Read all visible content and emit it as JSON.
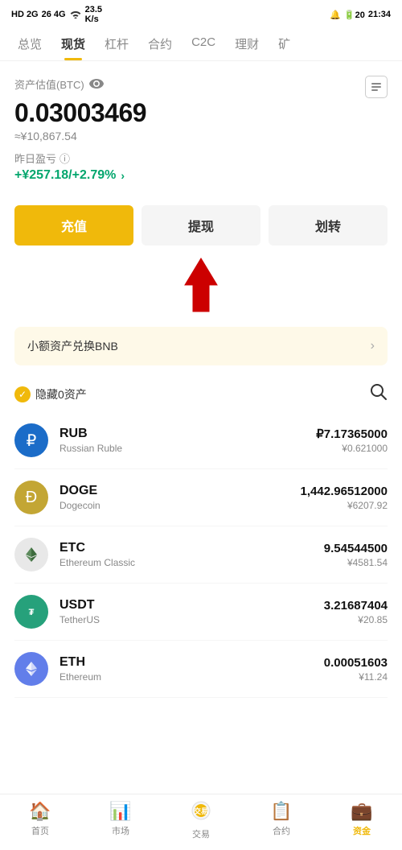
{
  "statusBar": {
    "left": "HD 2G 26 4G",
    "signal": "full",
    "wifi": "on",
    "speed": "23.5 K/s",
    "time": "21:34",
    "battery": "20"
  },
  "topNav": {
    "items": [
      {
        "id": "overview",
        "label": "总览",
        "active": false
      },
      {
        "id": "spot",
        "label": "现货",
        "active": true
      },
      {
        "id": "leverage",
        "label": "杠杆",
        "active": false
      },
      {
        "id": "contract",
        "label": "合约",
        "active": false
      },
      {
        "id": "c2c",
        "label": "C2C",
        "active": false
      },
      {
        "id": "finance",
        "label": "理财",
        "active": false
      },
      {
        "id": "mining",
        "label": "矿",
        "active": false
      }
    ]
  },
  "asset": {
    "label": "资产估值(BTC)",
    "btcValue": "0.03003469",
    "cnyApprox": "≈¥10,867.54",
    "yesterdayLabel": "昨日盈亏",
    "profitValue": "+¥257.18/+2.79%"
  },
  "buttons": {
    "deposit": "充值",
    "withdraw": "提现",
    "transfer": "划转"
  },
  "smallAssets": {
    "label": "小额资产兑换BNB"
  },
  "filter": {
    "hideLabel": "隐藏0资产"
  },
  "coins": [
    {
      "symbol": "RUB",
      "name": "Russian Ruble",
      "amount": "₽7.17365000",
      "cny": "¥0.621000",
      "iconType": "rub"
    },
    {
      "symbol": "DOGE",
      "name": "Dogecoin",
      "amount": "1,442.96512000",
      "cny": "¥6207.92",
      "iconType": "doge"
    },
    {
      "symbol": "ETC",
      "name": "Ethereum Classic",
      "amount": "9.54544500",
      "cny": "¥4581.54",
      "iconType": "etc"
    },
    {
      "symbol": "USDT",
      "name": "TetherUS",
      "amount": "3.21687404",
      "cny": "¥20.85",
      "iconType": "usdt"
    },
    {
      "symbol": "ETH",
      "name": "Ethereum",
      "amount": "0.00051603",
      "cny": "¥11.24",
      "iconType": "eth"
    }
  ],
  "bottomNav": {
    "items": [
      {
        "id": "home",
        "label": "首页",
        "icon": "🏠",
        "active": false
      },
      {
        "id": "market",
        "label": "市场",
        "icon": "📊",
        "active": false
      },
      {
        "id": "trade",
        "label": "交易",
        "icon": "🔄",
        "active": false
      },
      {
        "id": "futures",
        "label": "合约",
        "icon": "📋",
        "active": false
      },
      {
        "id": "assets",
        "label": "资金",
        "icon": "💼",
        "active": true
      }
    ]
  }
}
